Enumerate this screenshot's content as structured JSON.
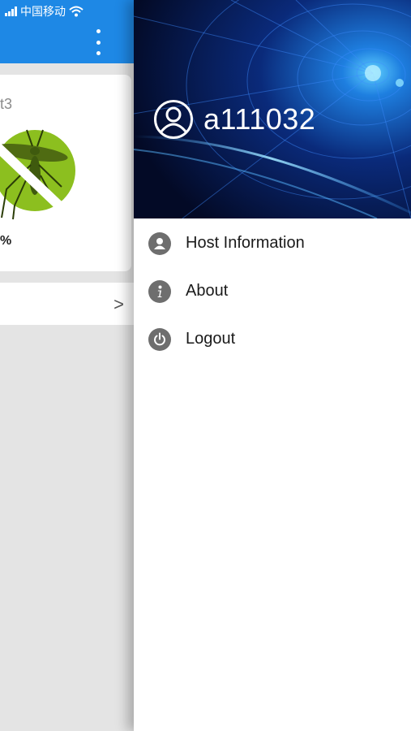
{
  "status_bar": {
    "carrier": "中国移动"
  },
  "background_screen": {
    "card_count_text": "t3",
    "card_percent_text": "%",
    "row_chevron": ">"
  },
  "drawer": {
    "username": "a111032",
    "menu": [
      {
        "label": "Host Information",
        "icon": "person-icon"
      },
      {
        "label": "About",
        "icon": "info-icon"
      },
      {
        "label": "Logout",
        "icon": "power-icon"
      }
    ]
  },
  "colors": {
    "header_blue": "#1e88e5",
    "mosquito_green": "#8cbf1f",
    "menu_icon_gray": "#6e6e6e"
  }
}
